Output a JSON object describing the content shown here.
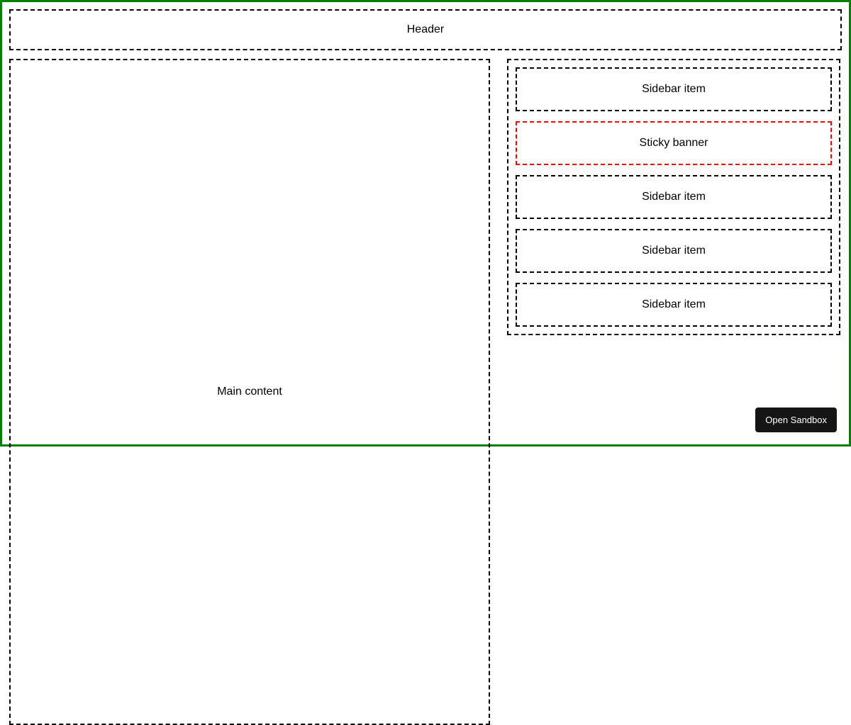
{
  "header": {
    "label": "Header"
  },
  "main": {
    "label": "Main content"
  },
  "sidebar": {
    "items": [
      {
        "label": "Sidebar item"
      },
      {
        "label": "Sticky banner"
      },
      {
        "label": "Sidebar item"
      },
      {
        "label": "Sidebar item"
      },
      {
        "label": "Sidebar item"
      }
    ]
  },
  "footer": {
    "open_sandbox_label": "Open Sandbox"
  },
  "colors": {
    "frame": "#008000",
    "dash": "#000000",
    "sticky": "#ff0000",
    "button_bg": "#151515",
    "button_fg": "#ffffff"
  }
}
